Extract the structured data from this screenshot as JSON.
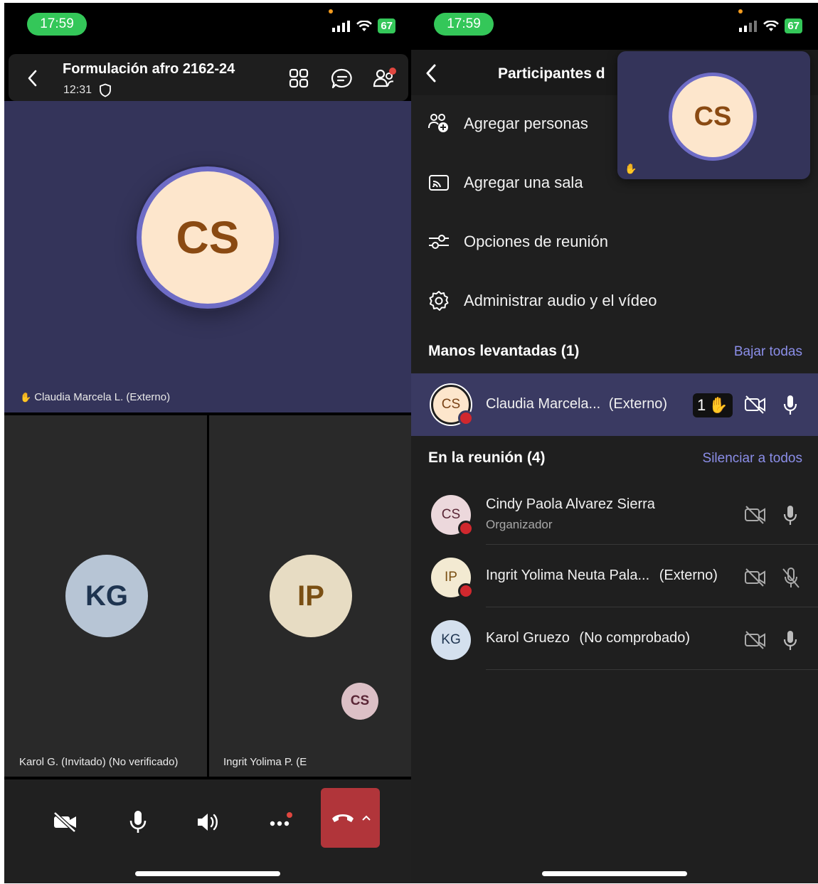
{
  "status_bar": {
    "time": "17:59",
    "battery": "67"
  },
  "call": {
    "title": "Formulación afro 2162-24",
    "timer": "12:31"
  },
  "stage": {
    "active_initials": "CS",
    "active_name": "Claudia Marcela L. (Externo)"
  },
  "tiles": [
    {
      "initials": "KG",
      "name": "Karol G. (Invitado) (No verificado)"
    },
    {
      "initials": "IP",
      "name": "Ingrit Yolima P. (E"
    }
  ],
  "self_view": {
    "initials": "CS"
  },
  "participants_panel": {
    "title": "Participantes d",
    "pip_initials": "CS",
    "menu": [
      {
        "label": "Agregar personas",
        "icon": "add-people-icon"
      },
      {
        "label": "Agregar una sala",
        "icon": "cast-room-icon"
      },
      {
        "label": "Opciones de reunión",
        "icon": "sliders-icon"
      },
      {
        "label": "Administrar audio y el vídeo",
        "icon": "gear-icon"
      }
    ],
    "raised_hands": {
      "header": "Manos levantadas (1)",
      "action": "Bajar todas",
      "people": [
        {
          "initials": "CS",
          "name": "Claudia Marcela...",
          "tag": "(Externo)",
          "hand_count": "1"
        }
      ]
    },
    "in_meeting": {
      "header": "En la reunión (4)",
      "action": "Silenciar a todos",
      "people": [
        {
          "initials": "CS",
          "name": "Cindy Paola Alvarez Sierra",
          "role": "Organizador",
          "mic": "on"
        },
        {
          "initials": "IP",
          "name": "Ingrit Yolima Neuta Pala...",
          "tag": "(Externo)",
          "mic": "off"
        },
        {
          "initials": "KG",
          "name": "Karol Gruezo",
          "tag": "(No comprobado)",
          "mic": "on"
        }
      ]
    }
  },
  "colors": {
    "stage_bg": "#34345a",
    "accent": "#8b8ee8",
    "hangup": "#b1353a",
    "status_green": "#34c759"
  }
}
